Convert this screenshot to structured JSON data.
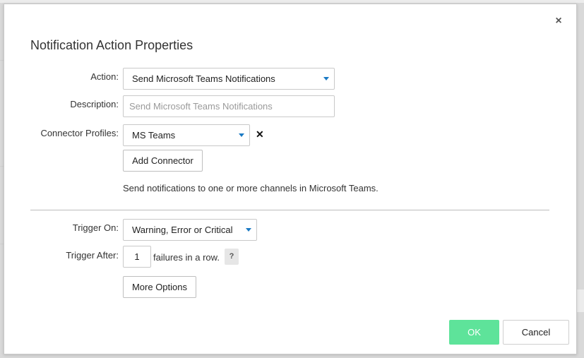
{
  "dialog": {
    "title": "Notification Action Properties"
  },
  "form": {
    "action_label": "Action:",
    "action_value": "Send Microsoft Teams Notifications",
    "description_label": "Description:",
    "description_placeholder": "Send Microsoft Teams Notifications",
    "connector_label": "Connector Profiles:",
    "connector_value": "MS Teams",
    "add_connector_label": "Add Connector",
    "hint": "Send notifications to one or more channels in Microsoft Teams.",
    "trigger_on_label": "Trigger On:",
    "trigger_on_value": "Warning, Error or Critical",
    "trigger_after_label": "Trigger After:",
    "trigger_after_value": "1",
    "trigger_after_suffix": "failures in a row.",
    "help_symbol": "?",
    "more_options_label": "More Options"
  },
  "footer": {
    "ok_label": "OK",
    "cancel_label": "Cancel"
  },
  "icons": {
    "close": "close-icon",
    "remove": "remove-icon",
    "caret": "caret-down-icon"
  },
  "colors": {
    "ok_button": "#5ee39a",
    "caret": "#1b7ac4"
  }
}
